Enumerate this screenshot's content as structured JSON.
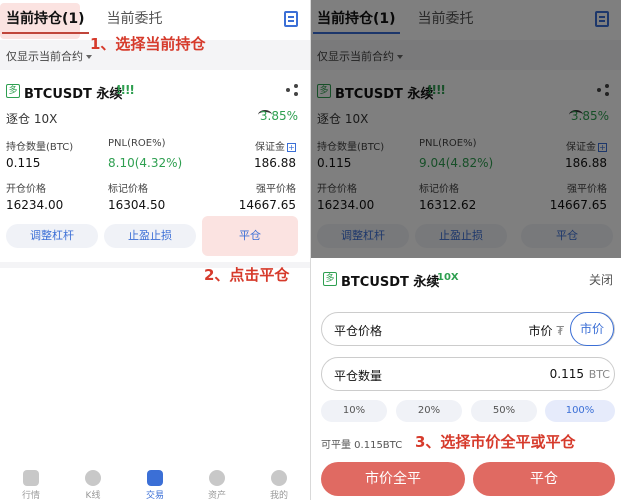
{
  "tabs": {
    "active": "当前持仓(1)",
    "inactive": "当前委托"
  },
  "filter_label": "仅显示当前合约",
  "annotations": {
    "step1": "1、选择当前持仓",
    "step2": "2、点击平仓",
    "step3": "3、选择市价全平或平仓"
  },
  "left": {
    "badge": "多",
    "symbol": "BTCUSDT 永续",
    "signal": "!!!!",
    "leverage": "逐仓 10X",
    "pct": "3.85%",
    "labels": {
      "qty": "持仓数量(BTC)",
      "pnl": "PNL(ROE%)",
      "margin": "保证金",
      "open": "开仓价格",
      "mark": "标记价格",
      "liq": "强平价格"
    },
    "values": {
      "qty": "0.115",
      "pnl": "8.10(4.32%)",
      "margin": "186.88",
      "open": "16234.00",
      "mark": "16304.50",
      "liq": "14667.65"
    },
    "buttons": {
      "adjust": "调整杠杆",
      "tpsl": "止盈止损",
      "close": "平仓"
    }
  },
  "right": {
    "badge": "多",
    "symbol": "BTCUSDT 永续",
    "signal": "!!!!",
    "leverage": "逐仓 10X",
    "pct": "3.85%",
    "labels": {
      "qty": "持仓数量(BTC)",
      "pnl": "PNL(ROE%)",
      "margin": "保证金",
      "open": "开仓价格",
      "mark": "标记价格",
      "liq": "强平价格"
    },
    "values": {
      "qty": "0.115",
      "pnl": "9.04(4.82%)",
      "margin": "186.88",
      "open": "16234.00",
      "mark": "16312.62",
      "liq": "14667.65"
    },
    "buttons": {
      "adjust": "调整杠杆",
      "tpsl": "止盈止损",
      "close": "平仓"
    },
    "sheet": {
      "badge": "多",
      "symbol": "BTCUSDT 永续",
      "lev_tag": "10X",
      "close": "关闭",
      "price_label": "平仓价格",
      "price_value": "市价",
      "price_unit": "₮",
      "market_btn": "市价",
      "qty_label": "平仓数量",
      "qty_value": "0.115",
      "qty_unit": "BTC",
      "pct_options": [
        "10%",
        "20%",
        "50%",
        "100%"
      ],
      "available": "可平量 0.115BTC",
      "market_close_all": "市价全平",
      "close_btn": "平仓"
    }
  },
  "nav": [
    "行情",
    "K线",
    "交易",
    "资产",
    "我的"
  ],
  "colors": {
    "accent": "#3b6fd6",
    "annotation": "#d63a2b",
    "profit": "#2e9f50",
    "close_btn": "#e06a62"
  }
}
